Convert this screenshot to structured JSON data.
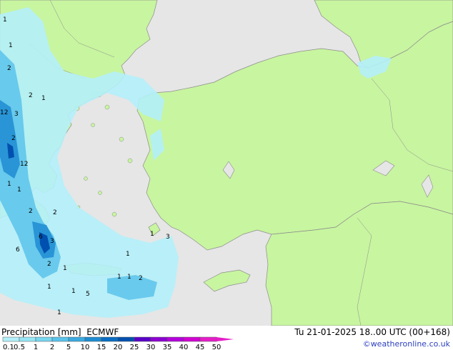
{
  "header": {
    "product_label": "Precipitation [mm]",
    "model_label": "ECMWF",
    "valid_time": "Tu 21-01-2025 18..00 UTC (00+168)",
    "credit": "©weatheronline.co.uk"
  },
  "legend": {
    "ticks": [
      "0.1",
      "0.5",
      "1",
      "2",
      "5",
      "10",
      "15",
      "20",
      "25",
      "30",
      "35",
      "40",
      "45",
      "50"
    ],
    "colors": [
      "#b4f0fa",
      "#96e6f5",
      "#78d7f0",
      "#5ac3eb",
      "#3caae1",
      "#1e8cd2",
      "#0a6ec3",
      "#0050af",
      "#5a00c8",
      "#8c00d2",
      "#b400dc",
      "#d200d2",
      "#e61ec8"
    ]
  },
  "colors": {
    "land": "#c8f5a0",
    "sea": "#e6e6e6",
    "coast": "#8c8c8c",
    "light_precip": "#b4f0fa",
    "moderate_precip": "#5ac3eb",
    "heavy_precip": "#1e8cd2",
    "very_heavy_precip": "#0050af"
  },
  "map": {
    "precip_labels": [
      "1",
      "2",
      "1",
      "2",
      "1",
      "3",
      "12",
      "2",
      "12",
      "1",
      "1",
      "2",
      "2",
      "6",
      "3",
      "2",
      "1",
      "6",
      "1",
      "1",
      "5",
      "1",
      "1",
      "1",
      "1",
      "2",
      "1",
      "3"
    ]
  }
}
